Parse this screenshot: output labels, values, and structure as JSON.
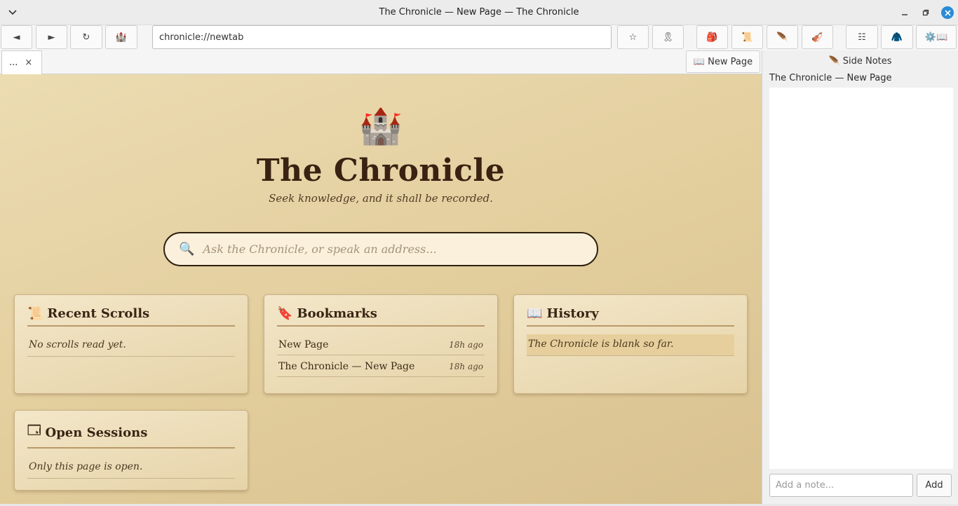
{
  "window": {
    "title": "The Chronicle — New Page — The Chronicle",
    "menu_icon": "chevron-down",
    "min_icon": "minimize",
    "max_icon": "restore",
    "close_icon": "close"
  },
  "toolbar": {
    "back": "◄",
    "forward": "►",
    "reload": "↻",
    "home": "🏰",
    "url": "chronicle://newtab",
    "bookmark_star": "☆",
    "ribbon": "🎗",
    "pack": "🎒",
    "scroll": "📜",
    "quill": "🪶",
    "fiddle": "🎻",
    "list": "☷",
    "cloak": "🧥",
    "settings": "⚙️📖"
  },
  "tabs": [
    {
      "label": "...",
      "close": "×"
    }
  ],
  "new_page_button": {
    "icon": "📖",
    "label": "New Page"
  },
  "newtab": {
    "castle": "🏰",
    "brand": "The Chronicle",
    "tagline": "Seek knowledge, and it shall be recorded.",
    "search_icon": "🔍",
    "search_placeholder": "Ask the Chronicle, or speak an address...",
    "cards": {
      "recent": {
        "icon": "📜",
        "title": "Recent Scrolls",
        "empty": "No scrolls read yet."
      },
      "bookmarks": {
        "icon": "🔖",
        "title": "Bookmarks",
        "items": [
          {
            "label": "New Page",
            "ago": "18h ago"
          },
          {
            "label": "The Chronicle — New Page",
            "ago": "18h ago"
          }
        ]
      },
      "history": {
        "icon": "📖",
        "title": "History",
        "empty": "The Chronicle is blank so far."
      },
      "sessions": {
        "icon": "🗔",
        "title": "Open Sessions",
        "empty": "Only this page is open."
      }
    }
  },
  "sidebar": {
    "header": "🪶 Side Notes",
    "page_title": "The Chronicle — New Page",
    "note_placeholder": "Add a note...",
    "add_label": "Add"
  }
}
